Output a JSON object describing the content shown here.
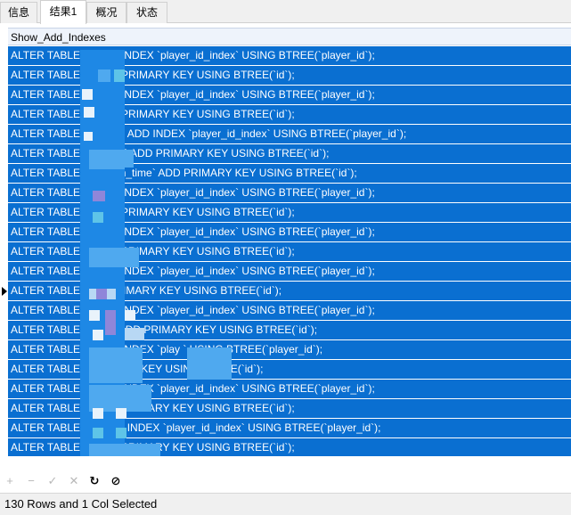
{
  "tabs": [
    {
      "label": "信息",
      "active": false
    },
    {
      "label": "结果1",
      "active": true
    },
    {
      "label": "概况",
      "active": false
    },
    {
      "label": "状态",
      "active": false
    }
  ],
  "grid": {
    "column_header": "Show_Add_Indexes",
    "selected_color": "#0a6fd1",
    "rows": [
      "ALTER TABLE `            ` ADD INDEX `player_id_index` USING BTREE(`player_id`);",
      "ALTER TABLE `            ` ADD PRIMARY KEY USING BTREE(`id`);",
      "ALTER TABLE `          ` ADD INDEX `player_id_index` USING BTREE(`player_id`);",
      "ALTER TABLE `          ` ADD PRIMARY KEY USING BTREE(`id`);",
      "ALTER TABLE `                   nc_log` ADD INDEX `player_id_index` USING BTREE(`player_id`);",
      "ALTER TABLE `t                  nc_log` ADD PRIMARY KEY USING BTREE(`id`);",
      "ALTER TABLE `t           refresh_time` ADD PRIMARY KEY USING BTREE(`id`);",
      "ALTER TABLE `        ` ADD INDEX `player_id_index` USING BTREE(`player_id`);",
      "ALTER TABLE `        ` ADD PRIMARY KEY USING BTREE(`id`);",
      "ALTER TABLE `               ` ADD INDEX `player_id_index` USING BTREE(`player_id`);",
      "ALTER TABLE `               ` ADD PRIMARY KEY USING BTREE(`id`);",
      "ALTER TABLE `          ` ADD INDEX `player_id_index` USING BTREE(`player_id`);",
      "ALTER TABLE `             DD PRIMARY KEY USING BTREE(`id`);",
      "ALTER TABLE `              ` ADD INDEX `player_id_index` USING BTREE(`player_id`);",
      "ALTER TABLE `        nlev    ` ADD PRIMARY KEY USING BTREE(`id`);",
      "ALTER TABLE `       ` ADD INDEX `play                ` USING BTREE(`player_id`);",
      "ALTER TABLE `                 PRIMARY KEY USING BTREE(`id`);",
      "ALTER TABLE `                  ` ADD INDEX `player_id_index` USING BTREE(`player_id`);",
      "ALTER TABLE `                  ` ADD PRIMARY KEY USING BTREE(`id`);",
      "ALTER TABLE `              g` ADD INDEX `player_id_index` USING BTREE(`player_id`);",
      "ALTER TABLE `                 ` ADD PRIMARY KEY USING BTREE(`id`);"
    ],
    "current_row_index": 12
  },
  "toolbar": {
    "add_icon": "+",
    "delete_icon": "−",
    "apply_icon": "✓",
    "cancel_icon": "✕",
    "refresh_icon": "↻",
    "stop_icon": "⊘"
  },
  "status": {
    "text": "130 Rows and 1 Col Selected"
  }
}
